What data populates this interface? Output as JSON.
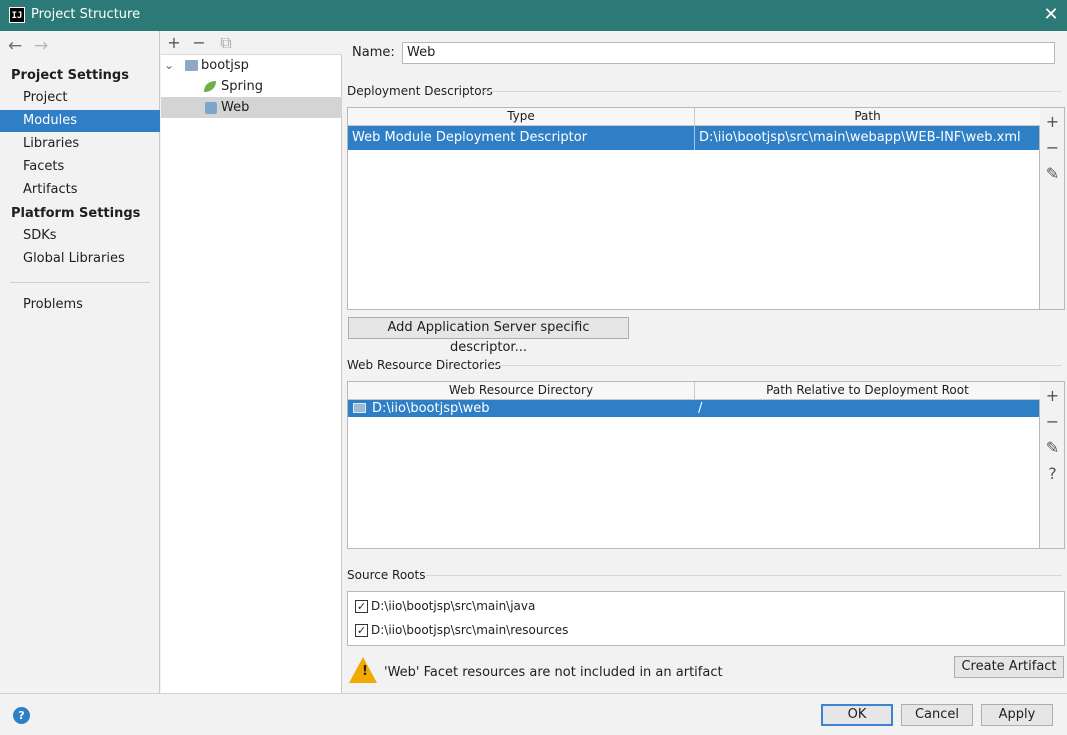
{
  "window": {
    "title": "Project Structure",
    "close_glyph": "✕",
    "app_icon_text": "IJ"
  },
  "nav": {
    "back": "←",
    "forward": "→"
  },
  "sidebar": {
    "project_settings_heading": "Project Settings",
    "project_settings_items": [
      "Project",
      "Modules",
      "Libraries",
      "Facets",
      "Artifacts"
    ],
    "platform_settings_heading": "Platform Settings",
    "platform_settings_items": [
      "SDKs",
      "Global Libraries"
    ],
    "problems_label": "Problems",
    "selected_item": "Modules"
  },
  "tree": {
    "toolbar": {
      "add": "+",
      "remove": "−",
      "copy": "⧉"
    },
    "root": {
      "label": "bootjsp",
      "expander": "⌄"
    },
    "children": [
      {
        "label": "Spring",
        "icon": "spring-leaf-icon"
      },
      {
        "label": "Web",
        "icon": "web-module-icon"
      }
    ],
    "selected": "Web"
  },
  "main": {
    "name_label": "Name:",
    "name_value": "Web",
    "deployment_descriptors": {
      "title": "Deployment Descriptors",
      "columns": [
        "Type",
        "Path"
      ],
      "rows": [
        {
          "type": "Web Module Deployment Descriptor",
          "path": "D:\\iio\\bootjsp\\src\\main\\webapp\\WEB-INF\\web.xml"
        }
      ],
      "add_server_button": "Add Application Server specific descriptor..."
    },
    "web_resource_directories": {
      "title": "Web Resource Directories",
      "columns": [
        "Web Resource Directory",
        "Path Relative to Deployment Root"
      ],
      "rows": [
        {
          "directory": "D:\\iio\\bootjsp\\web",
          "relative_path": "/"
        }
      ]
    },
    "side_tools": {
      "add": "+",
      "remove": "−",
      "edit": "✎",
      "help": "?"
    },
    "source_roots": {
      "title": "Source Roots",
      "items": [
        {
          "path": "D:\\iio\\bootjsp\\src\\main\\java",
          "checked": true
        },
        {
          "path": "D:\\iio\\bootjsp\\src\\main\\resources",
          "checked": true
        }
      ],
      "check_glyph": "✓"
    },
    "warning": {
      "text": "'Web' Facet resources are not included in an artifact",
      "create_artifact_button": "Create Artifact",
      "icon_glyph": "!"
    }
  },
  "footer": {
    "help_glyph": "?",
    "ok": "OK",
    "cancel": "Cancel",
    "apply": "Apply"
  },
  "colors": {
    "title_bar": "#2b7a78",
    "selection": "#2f7fc6",
    "warning": "#f2a900"
  }
}
